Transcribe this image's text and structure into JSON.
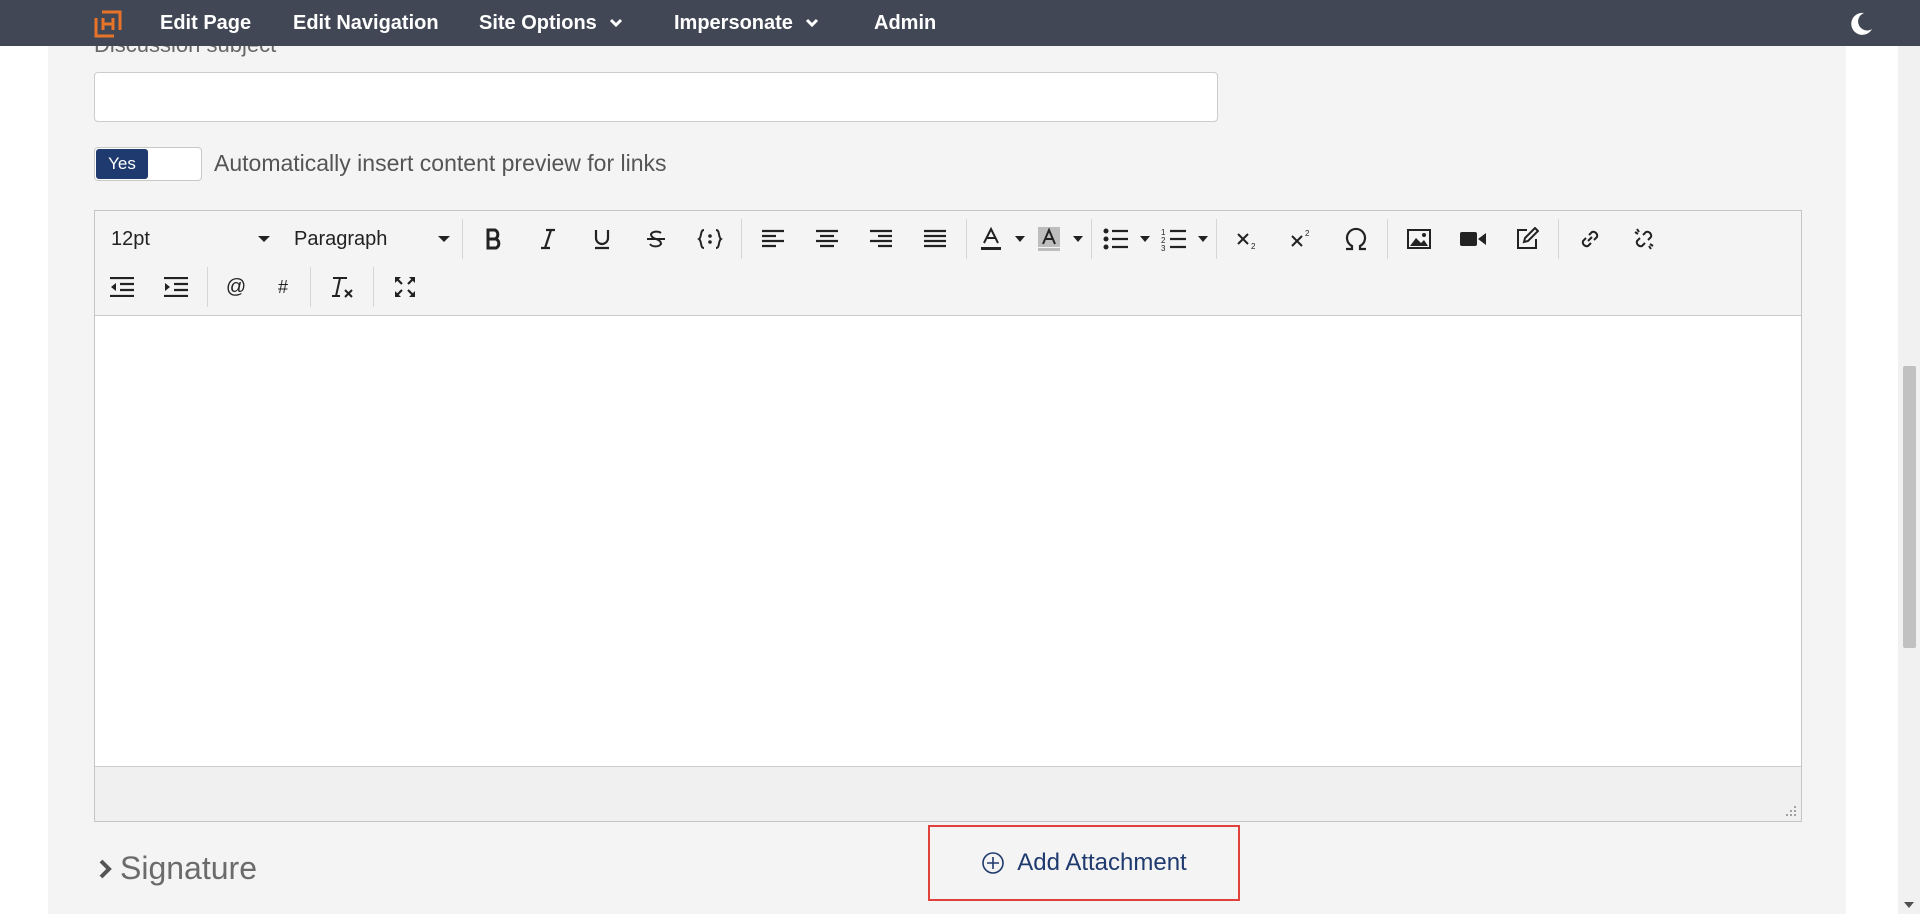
{
  "nav": {
    "items": [
      {
        "label": "Edit Page",
        "dropdown": false
      },
      {
        "label": "Edit Navigation",
        "dropdown": false
      },
      {
        "label": "Site Options",
        "dropdown": true
      },
      {
        "label": "Impersonate",
        "dropdown": true
      },
      {
        "label": "Admin",
        "dropdown": false
      }
    ],
    "bg_color": "#414754",
    "logo_color": "#e8742a"
  },
  "form": {
    "subject_label": "Discussion subject",
    "subject_value": "",
    "toggle_state": "Yes",
    "toggle_label": "Automatically insert content preview for links"
  },
  "editor": {
    "font_size": "12pt",
    "block_format": "Paragraph",
    "toolbar_row1": [
      "bold",
      "italic",
      "underline",
      "strikethrough",
      "code",
      "align-left",
      "align-center",
      "align-right",
      "align-justify",
      "text-color",
      "highlight-color",
      "bullet-list",
      "numbered-list",
      "subscript",
      "superscript",
      "special-character",
      "image",
      "video",
      "edit",
      "link",
      "unlink"
    ],
    "toolbar_row2": [
      "outdent",
      "indent",
      "mention",
      "hashtag",
      "clear-format",
      "fullscreen"
    ],
    "mention_label": "@",
    "hashtag_label": "#"
  },
  "signature": {
    "label": "Signature"
  },
  "attachment": {
    "label": "Add Attachment",
    "highlight_color": "#e0413b"
  }
}
